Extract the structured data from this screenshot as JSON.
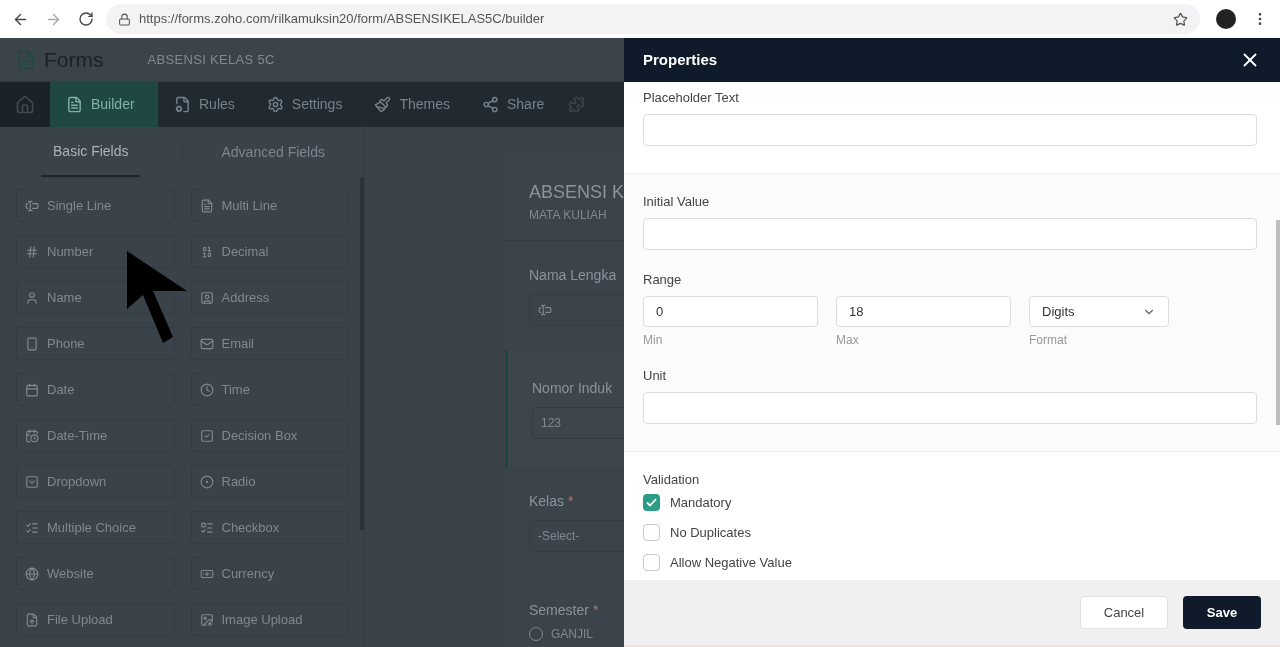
{
  "browser": {
    "url": "https://forms.zoho.com/rilkamuksin20/form/ABSENSIKELAS5C/builder"
  },
  "app": {
    "brand": "Forms",
    "form_name": "ABSENSI KELAS 5C",
    "nav": [
      {
        "label": "Builder",
        "selected": true
      },
      {
        "label": "Rules",
        "selected": false
      },
      {
        "label": "Settings",
        "selected": false
      },
      {
        "label": "Themes",
        "selected": false
      },
      {
        "label": "Share",
        "selected": false
      }
    ],
    "field_tabs": [
      {
        "label": "Basic Fields",
        "selected": true
      },
      {
        "label": "Advanced Fields",
        "selected": false
      }
    ],
    "fields": [
      "Single Line",
      "Multi Line",
      "Number",
      "Decimal",
      "Name",
      "Address",
      "Phone",
      "Email",
      "Date",
      "Time",
      "Date-Time",
      "Decision Box",
      "Dropdown",
      "Radio",
      "Multiple Choice",
      "Checkbox",
      "Website",
      "Currency",
      "File Upload",
      "Image Upload"
    ],
    "form": {
      "title": "ABSENSI K",
      "subtitle": "MATA KULIAH",
      "questions": [
        {
          "kind": "text",
          "label": "Nama Lengka",
          "selected": false
        },
        {
          "kind": "number",
          "label": "Nomor Induk",
          "placeholder": "123",
          "selected": true
        },
        {
          "kind": "dropdown",
          "label": "Kelas",
          "required_mark": "*",
          "placeholder": "-Select-",
          "selected": false
        },
        {
          "kind": "radio",
          "label": "Semester",
          "required_mark": "*",
          "options": [
            "GANJIL"
          ],
          "selected": false
        }
      ]
    }
  },
  "properties": {
    "title": "Properties",
    "placeholder_label": "Placeholder Text",
    "initial_value_label": "Initial Value",
    "range": {
      "label": "Range",
      "min": {
        "value": "0",
        "caption": "Min"
      },
      "max": {
        "value": "18",
        "caption": "Max"
      },
      "format": {
        "value": "Digits",
        "caption": "Format"
      }
    },
    "unit_label": "Unit",
    "validation": {
      "label": "Validation",
      "options": [
        {
          "label": "Mandatory",
          "checked": true
        },
        {
          "label": "No Duplicates",
          "checked": false
        },
        {
          "label": "Allow Negative Value",
          "checked": false
        }
      ]
    },
    "buttons": {
      "cancel": "Cancel",
      "save": "Save"
    }
  }
}
